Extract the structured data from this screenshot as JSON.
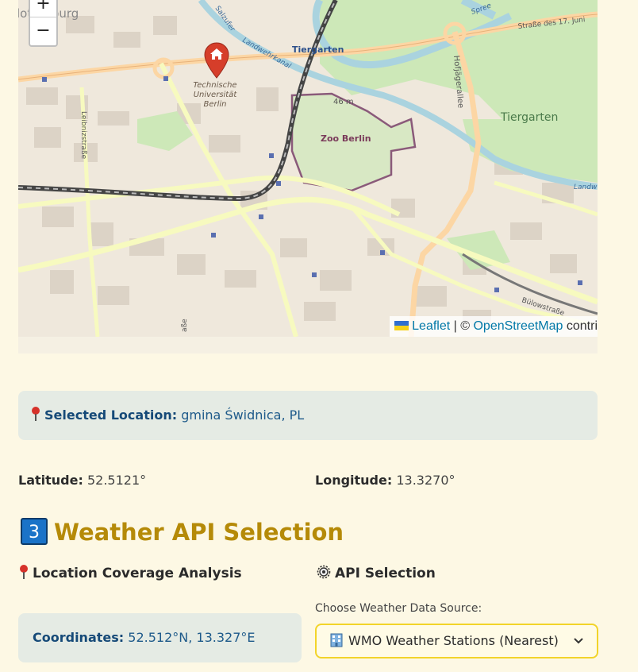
{
  "map": {
    "zoom_in": "+",
    "zoom_out": "−",
    "labels": {
      "tiergarten_station": "Tiergarten",
      "strasse_17_juni": "Straße des 17. Juni",
      "tu_line1": "Technische",
      "tu_line2": "Universität",
      "tu_line3": "Berlin",
      "zoo": "Zoo Berlin",
      "altitude": "46 m",
      "tiergarten_park": "Tiergarten",
      "hofjaegerallee": "Hofjägerallee",
      "leibnizstrasse": "Leibnizstraße",
      "salzufer": "Salzufer",
      "landwehrkanal": "Landwehrkanal",
      "spree": "Spree",
      "bulowstrasse": "Bülowstraße",
      "landwehr_right": "Landw",
      "charlottenburg_partial": "lottenburg",
      "strasse_bottom": "aße"
    },
    "attribution": {
      "leaflet": "Leaflet",
      "separator": " | © ",
      "osm": "OpenStreetMap",
      "contrib": " contri"
    },
    "colors": {
      "land": "#efe8dc",
      "park": "#cde8b8",
      "water": "#aad3df",
      "major_road": "#f7fabf",
      "primary_road": "#fcd6a4",
      "rail": "#555555",
      "marker": "#d63e2a"
    },
    "icons": {
      "marker": "home-icon"
    }
  },
  "selected_location": {
    "icon": "pushpin-icon",
    "label": "Selected Location:",
    "value": "gmina Świdnica, PL"
  },
  "coordinates": {
    "latitude_label": "Latitude:",
    "latitude_value": "52.5121°",
    "longitude_label": "Longitude:",
    "longitude_value": "13.3270°"
  },
  "weather_section": {
    "number": "3",
    "title": "Weather API Selection",
    "title_color": "#b58a08",
    "coverage_heading": "Location Coverage Analysis",
    "coverage_icon": "pushpin-icon",
    "api_heading": "API Selection",
    "api_icon": "gear-icon",
    "coverage_box": {
      "label": "Coordinates:",
      "value": "52.512°N, 13.327°E"
    },
    "dropdown": {
      "label": "Choose Weather Data Source:",
      "icon": "building-icon",
      "selected": "WMO Weather Stations (Nearest)",
      "border_color": "#f2d42a"
    }
  }
}
